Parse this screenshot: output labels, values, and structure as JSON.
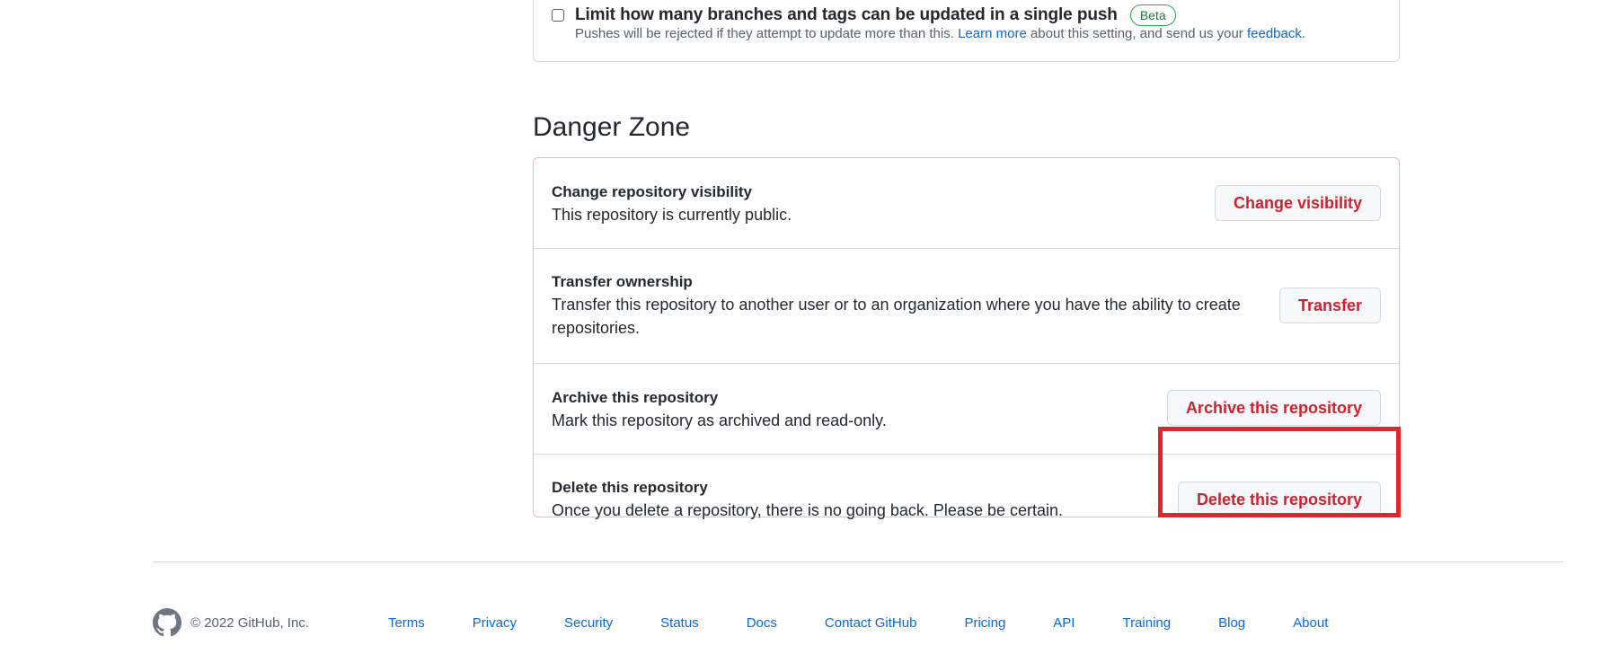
{
  "push_limit": {
    "title": "Limit how many branches and tags can be updated in a single push",
    "badge": "Beta",
    "note_prefix": "Pushes will be rejected if they attempt to update more than this.",
    "learn_more": "Learn more",
    "note_middle": "about this setting, and send us your",
    "feedback": "feedback",
    "note_suffix": "."
  },
  "danger_zone": {
    "heading": "Danger Zone",
    "rows": [
      {
        "title": "Change repository visibility",
        "description": "This repository is currently public.",
        "button": "Change visibility"
      },
      {
        "title": "Transfer ownership",
        "description": "Transfer this repository to another user or to an organization where you have the ability to create repositories.",
        "button": "Transfer"
      },
      {
        "title": "Archive this repository",
        "description": "Mark this repository as archived and read-only.",
        "button": "Archive this repository"
      },
      {
        "title": "Delete this repository",
        "description": "Once you delete a repository, there is no going back. Please be certain.",
        "button": "Delete this repository"
      }
    ]
  },
  "footer": {
    "copyright": "© 2022 GitHub, Inc.",
    "links": [
      "Terms",
      "Privacy",
      "Security",
      "Status",
      "Docs",
      "Contact GitHub",
      "Pricing",
      "API",
      "Training",
      "Blog",
      "About"
    ]
  },
  "colors": {
    "danger": "#cf222e",
    "link": "#0969da",
    "highlight": "#ea2127",
    "beta": "#1a7f37"
  },
  "icons": {
    "footer_logo": "github-mark-icon"
  }
}
